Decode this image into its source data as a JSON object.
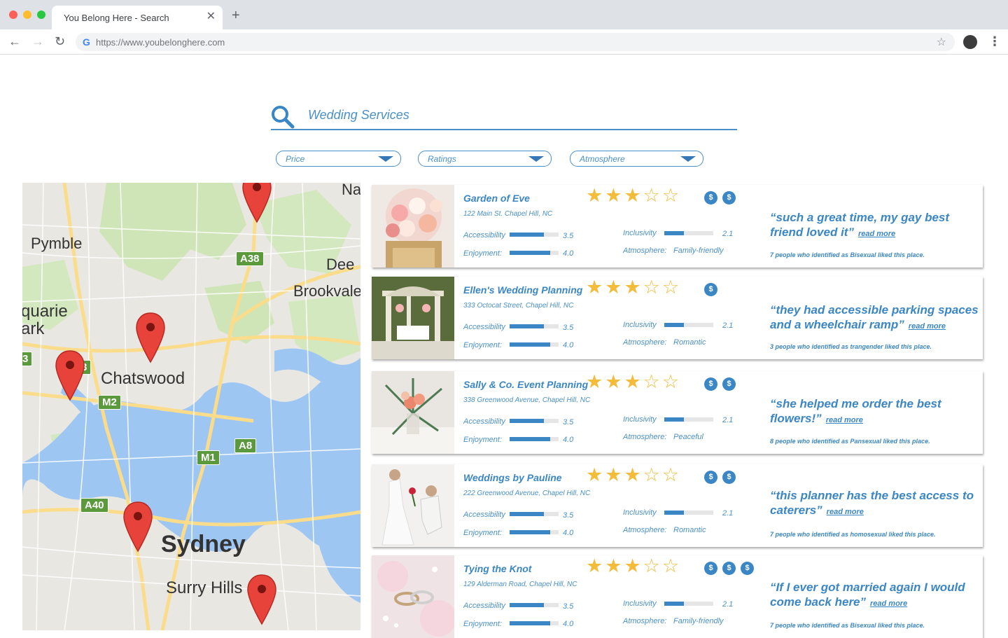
{
  "browser": {
    "tab_title": "You Belong Here - Search",
    "url": "https://www.youbelonghere.com"
  },
  "search": {
    "value": "Wedding Services"
  },
  "filters": [
    {
      "label": "Price"
    },
    {
      "label": "Ratings"
    },
    {
      "label": "Atmosphere"
    }
  ],
  "map": {
    "labels": [
      "Pymble",
      "Chatswood",
      "Sydney",
      "Surry Hills",
      "Brookvale",
      "Dee",
      "Na",
      "quarie",
      "ark"
    ],
    "roads": [
      "A38",
      "M2",
      "M1",
      "A8",
      "A40",
      "3",
      "3"
    ]
  },
  "labels": {
    "accessibility": "Accessibility",
    "enjoyment": "Enjoyment:",
    "inclusivity": "Inclusivity",
    "atmosphere": "Atmosphere:",
    "read_more": "read more",
    "coin": "$"
  },
  "results": [
    {
      "name": "Garden of Eve",
      "address": "122 Main St. Chapel Hill, NC",
      "stars": 3,
      "max_stars": 5,
      "price_level": 2,
      "accessibility": "3.5",
      "enjoyment": "4.0",
      "inclusivity": "2.1",
      "accessibility_level": 0.7,
      "enjoyment_level": 0.83,
      "inclusivity_level": 0.4,
      "atmosphere": "Family-friendly",
      "quote": "“such a great time, my gay best friend loved it”",
      "liked": "7 people who identified as Bisexual liked this place."
    },
    {
      "name": "Ellen's Wedding Planning",
      "address": "333 Octocat Street, Chapel Hill, NC",
      "stars": 3,
      "max_stars": 5,
      "price_level": 1,
      "accessibility": "3.5",
      "enjoyment": "4.0",
      "inclusivity": "2.1",
      "accessibility_level": 0.7,
      "enjoyment_level": 0.83,
      "inclusivity_level": 0.4,
      "atmosphere": "Romantic",
      "quote": "“they had accessible parking spaces and a wheelchair ramp”",
      "liked": "3 people who identified as trangender liked this place."
    },
    {
      "name": "Sally & Co. Event Planning",
      "address": "338 Greenwood Avenue, Chapel Hill, NC",
      "stars": 3,
      "max_stars": 5,
      "price_level": 2,
      "accessibility": "3.5",
      "enjoyment": "4.0",
      "inclusivity": "2.1",
      "accessibility_level": 0.7,
      "enjoyment_level": 0.83,
      "inclusivity_level": 0.4,
      "atmosphere": "Peaceful",
      "quote": "“she helped me order the best flowers!”",
      "liked": "8 people who identified as Pansexual liked this place."
    },
    {
      "name": "Weddings by Pauline",
      "address": "222 Greenwood Avenue, Chapel Hill, NC",
      "stars": 3,
      "max_stars": 5,
      "price_level": 2,
      "accessibility": "3.5",
      "enjoyment": "4.0",
      "inclusivity": "2.1",
      "accessibility_level": 0.7,
      "enjoyment_level": 0.83,
      "inclusivity_level": 0.4,
      "atmosphere": "Romantic",
      "quote": "“this planner has the best access to caterers”",
      "liked": "7 people who identified as homosexual liked this place."
    },
    {
      "name": "Tying the Knot",
      "address": "129 Alderman Road, Chapel Hill, NC",
      "stars": 3,
      "max_stars": 5,
      "price_level": 3,
      "accessibility": "3.5",
      "enjoyment": "4.0",
      "inclusivity": "2.1",
      "accessibility_level": 0.7,
      "enjoyment_level": 0.83,
      "inclusivity_level": 0.4,
      "atmosphere": "Family-friendly",
      "quote": "“If I ever got married again I would come back here”",
      "liked": "7 people who identified as Bisexual liked this place."
    }
  ]
}
